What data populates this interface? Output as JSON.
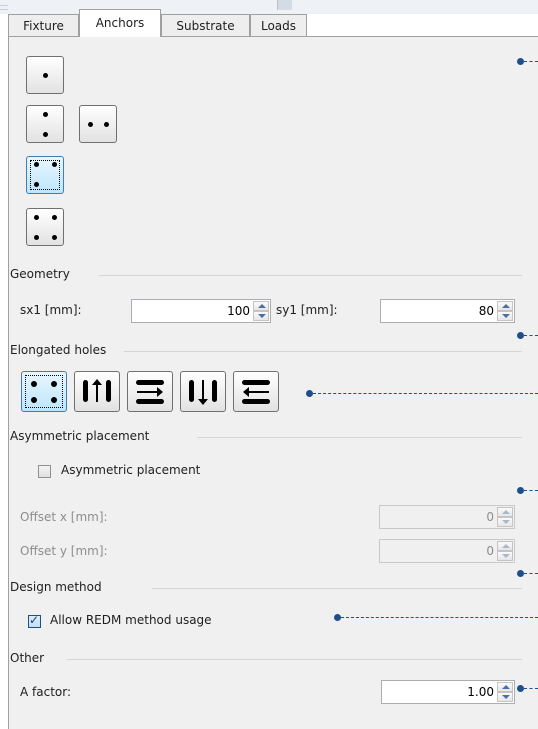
{
  "tabs": [
    {
      "label": "Fixture"
    },
    {
      "label": "Anchors"
    },
    {
      "label": "Substrate"
    },
    {
      "label": "Loads"
    }
  ],
  "geometry": {
    "heading": "Geometry",
    "sx1_label": "sx1 [mm]:",
    "sx1_value": "100",
    "sy1_label": "sy1 [mm]:",
    "sy1_value": "80"
  },
  "elongated_holes": {
    "heading": "Elongated holes"
  },
  "asymmetric": {
    "heading": "Asymmetric placement",
    "checkbox_label": "Asymmetric placement",
    "checked": false,
    "offset_x_label": "Offset x [mm]:",
    "offset_x_value": "0",
    "offset_y_label": "Offset y [mm]:",
    "offset_y_value": "0"
  },
  "design_method": {
    "heading": "Design method",
    "checkbox_label": "Allow REDM method usage",
    "checked": true
  },
  "other": {
    "heading": "Other",
    "a_factor_label": "A factor:",
    "a_factor_value": "1.00"
  },
  "colors": {
    "accent": "#1f4e8c",
    "selected_button": "#bde6fd"
  }
}
